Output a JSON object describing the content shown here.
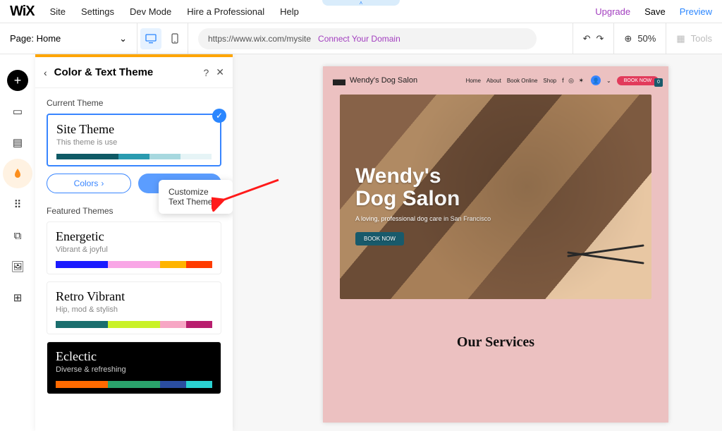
{
  "topbar": {
    "logo": "WiX",
    "menu": [
      "Site",
      "Settings",
      "Dev Mode",
      "Hire a Professional",
      "Help"
    ],
    "upgrade": "Upgrade",
    "save": "Save",
    "preview": "Preview",
    "notch_caret": "˄"
  },
  "toolbar": {
    "page_label": "Page:",
    "page_name": "Home",
    "url": "https://www.wix.com/mysite",
    "connect": "Connect Your Domain",
    "zoom": "50%",
    "tools": "Tools"
  },
  "panel": {
    "title": "Color & Text Theme",
    "current_label": "Current Theme",
    "site_theme_name": "Site Theme",
    "site_theme_desc": "This theme is use",
    "colors_btn": "Colors",
    "text_btn": "Text",
    "tooltip": "Customize Text Theme",
    "featured_label": "Featured Themes",
    "themes": [
      {
        "name": "Energetic",
        "desc": "Vibrant & joyful",
        "swatches": [
          "#1b1bff",
          "#1b1bff",
          "#f9a6e6",
          "#f9a6e6",
          "#ffb400",
          "#ff3b00"
        ]
      },
      {
        "name": "Retro Vibrant",
        "desc": "Hip, mod & stylish",
        "swatches": [
          "#1a6e6e",
          "#1a6e6e",
          "#c9f227",
          "#c9f227",
          "#f7a6c4",
          "#b81e6e"
        ]
      },
      {
        "name": "Eclectic",
        "desc": "Diverse & refreshing",
        "dark": true,
        "swatches": [
          "#ff6a00",
          "#ff6a00",
          "#2aa36b",
          "#2aa36b",
          "#2a4da0",
          "#2ad1d1"
        ]
      }
    ],
    "site_swatches": [
      "#0f5a66",
      "#0f5a66",
      "#2a9bb0",
      "#a7d8df",
      "#e6f4f6"
    ]
  },
  "site": {
    "brand": "Wendy's Dog Salon",
    "nav": [
      "Home",
      "About",
      "Book Online",
      "Shop"
    ],
    "book_btn": "BOOK NOW",
    "badge_zero": "0",
    "hero_title_l1": "Wendy's",
    "hero_title_l2": "Dog Salon",
    "hero_sub": "A loving, professional dog care in San Francisco",
    "hero_cta": "BOOK NOW",
    "services_heading": "Our Services"
  }
}
